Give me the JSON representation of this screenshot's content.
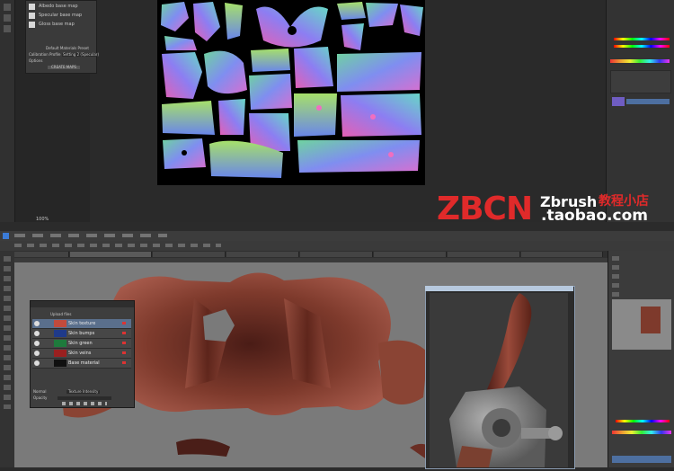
{
  "top_window": {
    "map_panel": {
      "rows": [
        {
          "label": "Albedo base map"
        },
        {
          "label": "Specular base map"
        },
        {
          "label": "Gloss base map"
        }
      ],
      "section_title": "Default Materials Preset",
      "calibration_label": "Calibration Profile",
      "calibration_value": "Setting 2 (Specular)",
      "options_label": "Options",
      "create_label": "CREATE MAPS"
    },
    "status_text": "100%"
  },
  "watermark": {
    "brand": "ZBCN",
    "product": "Zbrush",
    "store": "教程小店",
    "domain": ".taobao.com",
    "brand_color": "#e02a2a"
  },
  "bottom_window": {
    "layers_dialog": {
      "title": "Upload files",
      "layers": [
        {
          "label": "Skin texture",
          "swatch": "#c24b3c"
        },
        {
          "label": "Skin bumps",
          "swatch": "#1f3a8a"
        },
        {
          "label": "Skin green",
          "swatch": "#1e7a3c"
        },
        {
          "label": "Skin veins",
          "swatch": "#9a2020"
        },
        {
          "label": "Base material",
          "swatch": "#101010"
        }
      ],
      "footer_left": "Normal",
      "footer_right": "Texture Intensity",
      "footer_label": "Opacity"
    }
  },
  "colors": {
    "skin_dark": "#3c1612",
    "skin_mid": "#7e3a2c",
    "skin_light": "#a5594a",
    "canvas_gray": "#7a7a7a"
  }
}
